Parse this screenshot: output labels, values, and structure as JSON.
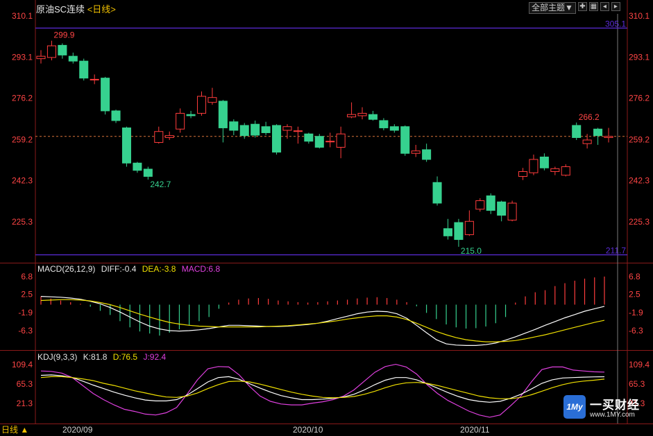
{
  "header": {
    "symbol": "原油SC连续",
    "period": "<日线>"
  },
  "toolbar": {
    "theme_label": "全部主题▼"
  },
  "colors": {
    "up": "#ff3c3c",
    "down": "#36d18f",
    "axis": "#ff4545",
    "diff": "#ffffff",
    "dea": "#f0e000",
    "macd": "#e040e0",
    "hline": "#5b2bd8"
  },
  "price_axis": {
    "ticks": [
      "310.1",
      "293.1",
      "276.2",
      "259.2",
      "242.3",
      "225.3"
    ]
  },
  "macd_axis": {
    "ticks": [
      "6.8",
      "2.5",
      "-1.9",
      "-6.3"
    ]
  },
  "kdj_axis": {
    "ticks": [
      "109.4",
      "65.3",
      "21.3"
    ]
  },
  "annotations": {
    "high": "299.9",
    "low1": "242.7",
    "low2": "215.0",
    "recent_high": "266.2",
    "upper_line": "305.1",
    "lower_line": "211.7"
  },
  "macd": {
    "name": "MACD(26,12,9)",
    "diff": "DIFF:-0.4",
    "dea": "DEA:-3.8",
    "macd": "MACD:6.8"
  },
  "kdj": {
    "name": "KDJ(9,3,3)",
    "k": "K:81.8",
    "d": "D:76.5",
    "j": "J:92.4"
  },
  "dates": [
    "2020/09",
    "2020/10",
    "2020/11"
  ],
  "period_selector": "日线 ▲",
  "brand": {
    "mark": "1My",
    "name": "一买财经",
    "url": "www.1MY.com"
  },
  "chart_data": {
    "type": "candlestick",
    "upper_hline": 305.1,
    "lower_hline": 211.7,
    "current_price_line": 260.5,
    "candles": [
      {
        "o": 292.5,
        "h": 296.0,
        "l": 290.5,
        "c": 293.5
      },
      {
        "o": 293.0,
        "h": 299.9,
        "l": 291.8,
        "c": 297.8
      },
      {
        "o": 298.0,
        "h": 298.8,
        "l": 292.5,
        "c": 294.0
      },
      {
        "o": 293.5,
        "h": 295.0,
        "l": 290.5,
        "c": 291.5
      },
      {
        "o": 291.5,
        "h": 292.5,
        "l": 283.5,
        "c": 284.5
      },
      {
        "o": 284.0,
        "h": 286.0,
        "l": 282.0,
        "c": 284.0
      },
      {
        "o": 284.5,
        "h": 285.0,
        "l": 269.5,
        "c": 271.0
      },
      {
        "o": 271.0,
        "h": 271.5,
        "l": 266.0,
        "c": 267.0
      },
      {
        "o": 264.0,
        "h": 264.5,
        "l": 248.0,
        "c": 249.5
      },
      {
        "o": 249.5,
        "h": 250.0,
        "l": 245.5,
        "c": 246.5
      },
      {
        "o": 247.0,
        "h": 248.0,
        "l": 242.7,
        "c": 244.0
      },
      {
        "o": 258.0,
        "h": 264.5,
        "l": 257.5,
        "c": 262.5
      },
      {
        "o": 260.0,
        "h": 262.5,
        "l": 259.0,
        "c": 260.8
      },
      {
        "o": 263.5,
        "h": 272.0,
        "l": 262.0,
        "c": 270.0
      },
      {
        "o": 269.5,
        "h": 271.0,
        "l": 268.0,
        "c": 269.0
      },
      {
        "o": 270.0,
        "h": 279.0,
        "l": 269.0,
        "c": 277.0
      },
      {
        "o": 274.5,
        "h": 280.5,
        "l": 273.5,
        "c": 276.5
      },
      {
        "o": 275.0,
        "h": 275.5,
        "l": 258.0,
        "c": 264.0
      },
      {
        "o": 266.5,
        "h": 267.5,
        "l": 261.0,
        "c": 263.0
      },
      {
        "o": 265.0,
        "h": 266.0,
        "l": 259.5,
        "c": 260.8
      },
      {
        "o": 265.5,
        "h": 267.0,
        "l": 260.0,
        "c": 261.0
      },
      {
        "o": 264.5,
        "h": 266.5,
        "l": 261.0,
        "c": 262.0
      },
      {
        "o": 265.0,
        "h": 265.5,
        "l": 253.0,
        "c": 254.0
      },
      {
        "o": 263.0,
        "h": 265.5,
        "l": 259.5,
        "c": 264.5
      },
      {
        "o": 262.5,
        "h": 264.5,
        "l": 257.5,
        "c": 262.8
      },
      {
        "o": 261.5,
        "h": 262.0,
        "l": 257.5,
        "c": 258.5
      },
      {
        "o": 260.5,
        "h": 261.5,
        "l": 255.5,
        "c": 256.0
      },
      {
        "o": 258.5,
        "h": 262.0,
        "l": 256.0,
        "c": 258.5
      },
      {
        "o": 256.0,
        "h": 264.5,
        "l": 251.5,
        "c": 261.5
      },
      {
        "o": 268.5,
        "h": 274.5,
        "l": 268.0,
        "c": 269.5
      },
      {
        "o": 269.0,
        "h": 272.5,
        "l": 267.5,
        "c": 270.0
      },
      {
        "o": 269.5,
        "h": 271.0,
        "l": 267.0,
        "c": 267.5
      },
      {
        "o": 267.0,
        "h": 268.0,
        "l": 263.0,
        "c": 264.0
      },
      {
        "o": 264.5,
        "h": 265.5,
        "l": 262.0,
        "c": 263.0
      },
      {
        "o": 264.5,
        "h": 265.0,
        "l": 252.5,
        "c": 253.5
      },
      {
        "o": 253.5,
        "h": 257.0,
        "l": 252.0,
        "c": 254.5
      },
      {
        "o": 255.0,
        "h": 257.5,
        "l": 250.0,
        "c": 251.0
      },
      {
        "o": 241.5,
        "h": 244.0,
        "l": 232.0,
        "c": 233.0
      },
      {
        "o": 222.5,
        "h": 226.5,
        "l": 218.0,
        "c": 219.5
      },
      {
        "o": 225.0,
        "h": 226.5,
        "l": 215.0,
        "c": 218.0
      },
      {
        "o": 220.0,
        "h": 230.0,
        "l": 219.5,
        "c": 225.5
      },
      {
        "o": 230.5,
        "h": 235.0,
        "l": 229.5,
        "c": 234.0
      },
      {
        "o": 236.0,
        "h": 237.0,
        "l": 228.5,
        "c": 230.0
      },
      {
        "o": 233.5,
        "h": 234.0,
        "l": 225.5,
        "c": 228.0
      },
      {
        "o": 226.0,
        "h": 234.0,
        "l": 225.5,
        "c": 233.0
      },
      {
        "o": 244.0,
        "h": 247.5,
        "l": 242.5,
        "c": 246.0
      },
      {
        "o": 245.5,
        "h": 253.0,
        "l": 244.5,
        "c": 251.0
      },
      {
        "o": 252.0,
        "h": 253.5,
        "l": 246.5,
        "c": 247.5
      },
      {
        "o": 246.0,
        "h": 248.0,
        "l": 244.5,
        "c": 247.2
      },
      {
        "o": 244.5,
        "h": 249.0,
        "l": 244.0,
        "c": 248.0
      },
      {
        "o": 265.0,
        "h": 266.2,
        "l": 259.0,
        "c": 260.0
      },
      {
        "o": 257.5,
        "h": 261.5,
        "l": 255.5,
        "c": 259.0
      },
      {
        "o": 263.5,
        "h": 264.0,
        "l": 257.0,
        "c": 260.8
      },
      {
        "o": 260.0,
        "h": 264.0,
        "l": 258.0,
        "c": 260.5
      }
    ],
    "macd_hist": [
      2.0,
      1.5,
      1.0,
      0.6,
      0.2,
      -0.5,
      -1.5,
      -2.5,
      -4.0,
      -5.5,
      -6.5,
      -7.0,
      -7.5,
      -6.8,
      -6.0,
      -5.0,
      -4.0,
      -3.0,
      -1.0,
      0.5,
      1.2,
      1.5,
      1.6,
      1.4,
      1.0,
      0.8,
      0.6,
      0.5,
      0.6,
      0.8,
      1.0,
      1.2,
      1.5,
      1.7,
      1.8,
      1.6,
      1.2,
      0.6,
      -0.4,
      -2.0,
      -3.5,
      -4.8,
      -5.5,
      -5.8,
      -5.7,
      -5.3,
      -4.5,
      -3.0,
      0.5,
      2.0,
      3.0,
      3.5,
      4.5,
      5.2,
      5.8,
      6.3,
      6.6,
      6.8
    ],
    "macd_diff": [
      2.0,
      1.9,
      1.8,
      1.6,
      1.3,
      0.8,
      0.2,
      -0.7,
      -1.8,
      -3.0,
      -4.2,
      -5.2,
      -5.9,
      -6.3,
      -6.4,
      -6.3,
      -6.1,
      -5.8,
      -5.4,
      -5.0,
      -5.0,
      -5.1,
      -5.2,
      -5.3,
      -5.3,
      -5.2,
      -5.0,
      -4.8,
      -4.5,
      -4.0,
      -3.4,
      -2.8,
      -2.2,
      -1.8,
      -1.6,
      -1.7,
      -2.2,
      -3.3,
      -5.0,
      -6.8,
      -8.5,
      -9.5,
      -9.8,
      -9.9,
      -9.9,
      -9.7,
      -9.3,
      -8.6,
      -7.8,
      -6.9,
      -6.0,
      -5.0,
      -4.1,
      -3.2,
      -2.4,
      -1.6,
      -1.0,
      -0.4
    ],
    "macd_dea": [
      1.0,
      1.1,
      1.2,
      1.2,
      1.1,
      0.9,
      0.5,
      0.0,
      -0.7,
      -1.5,
      -2.3,
      -3.0,
      -3.7,
      -4.3,
      -4.7,
      -5.0,
      -5.2,
      -5.3,
      -5.4,
      -5.4,
      -5.4,
      -5.4,
      -5.4,
      -5.3,
      -5.2,
      -5.1,
      -4.9,
      -4.7,
      -4.5,
      -4.2,
      -3.9,
      -3.5,
      -3.2,
      -2.9,
      -2.7,
      -2.7,
      -3.0,
      -3.6,
      -4.5,
      -5.5,
      -6.5,
      -7.3,
      -8.0,
      -8.5,
      -8.8,
      -9.0,
      -9.0,
      -8.9,
      -8.7,
      -8.3,
      -7.8,
      -7.3,
      -6.7,
      -6.1,
      -5.5,
      -4.9,
      -4.3,
      -3.8
    ],
    "kdj_k": [
      85,
      86,
      84,
      80,
      72,
      63,
      55,
      47,
      40,
      34,
      29,
      27,
      27,
      30,
      40,
      55,
      70,
      80,
      82,
      76,
      66,
      56,
      47,
      39,
      34,
      30,
      30,
      31,
      33,
      36,
      42,
      52,
      64,
      74,
      80,
      80,
      75,
      66,
      56,
      46,
      37,
      30,
      26,
      24,
      26,
      33,
      42,
      54,
      67,
      75,
      79,
      80,
      81,
      81.5,
      81.8
    ],
    "kdj_d": [
      80,
      82,
      82,
      80,
      77,
      73,
      67,
      62,
      56,
      50,
      45,
      40,
      36,
      35,
      38,
      45,
      55,
      64,
      71,
      72,
      70,
      65,
      59,
      53,
      47,
      42,
      38,
      35,
      34,
      35,
      37,
      42,
      49,
      57,
      64,
      68,
      69,
      67,
      62,
      56,
      50,
      44,
      38,
      34,
      32,
      32,
      35,
      41,
      49,
      57,
      64,
      69,
      72,
      74,
      76.5
    ],
    "kdj_j": [
      95,
      94,
      90,
      80,
      62,
      44,
      30,
      18,
      8,
      3,
      -3,
      -5,
      0,
      12,
      42,
      75,
      100,
      105,
      104,
      86,
      60,
      38,
      26,
      20,
      18,
      18,
      22,
      25,
      30,
      38,
      52,
      72,
      92,
      105,
      110,
      104,
      88,
      64,
      44,
      28,
      16,
      4,
      -5,
      -10,
      -5,
      16,
      38,
      70,
      98,
      104,
      104,
      97,
      95,
      93,
      92.4
    ]
  }
}
